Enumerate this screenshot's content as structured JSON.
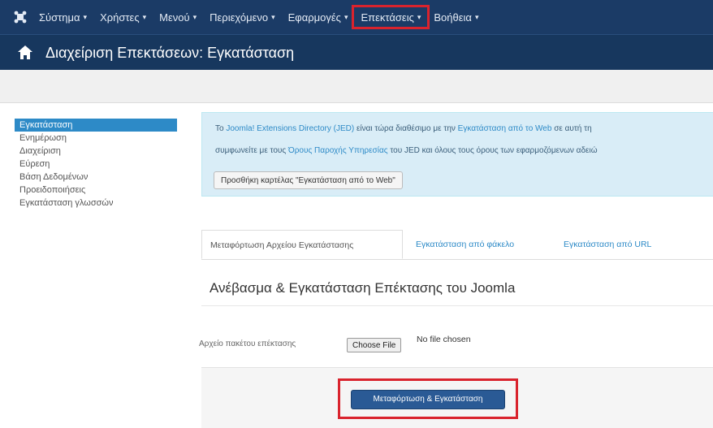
{
  "topbar": {
    "logo_icon": "joomla-logo-icon",
    "menu": [
      {
        "label": "Σύστημα"
      },
      {
        "label": "Χρήστες"
      },
      {
        "label": "Μενού"
      },
      {
        "label": "Περιεχόμενο"
      },
      {
        "label": "Εφαρμογές"
      },
      {
        "label": "Επεκτάσεις"
      },
      {
        "label": "Βοήθεια"
      }
    ],
    "caret": "▾",
    "highlight_color": "#d9232d",
    "background": "#1b3b66"
  },
  "titlebar": {
    "icon": "puzzle-home-icon",
    "title": "Διαχείριση Επεκτάσεων: Εγκατάσταση"
  },
  "sidebar": {
    "items": [
      {
        "label": "Εγκατάσταση"
      },
      {
        "label": "Ενημέρωση"
      },
      {
        "label": "Διαχείριση"
      },
      {
        "label": "Εύρεση"
      },
      {
        "label": "Βάση Δεδομένων"
      },
      {
        "label": "Προειδοποιήσεις"
      },
      {
        "label": "Εγκατάσταση γλωσσών"
      }
    ],
    "active_color": "#2d8ac7"
  },
  "notice": {
    "line1_a": "Το ",
    "line1_link1": "Joomla! Extensions Directory (JED)",
    "line1_b": " είναι τώρα διαθέσιμο με την ",
    "line1_link2": "Εγκατάσταση από το Web",
    "line1_c": " σε αυτή τη",
    "line2_a": "συμφωνείτε με τους ",
    "line2_link": "Όρους Παροχής Υπηρεσίας",
    "line2_b": " του JED και όλους τους όρους των εφαρμοζόμενων αδειώ",
    "button": "Προσθήκη καρτέλας \"Εγκατάσταση από το Web\""
  },
  "tabs": [
    {
      "label": "Μεταφόρτωση Αρχείου Εγκατάστασης"
    },
    {
      "label": "Εγκατάσταση από φάκελο"
    },
    {
      "label": "Εγκατάσταση από URL"
    }
  ],
  "section_title": "Ανέβασμα & Εγκατάσταση Επέκτασης του Joomla",
  "file_field": {
    "label": "Αρχείο πακέτου επέκτασης",
    "choose_button": "Choose File",
    "status": "No file chosen"
  },
  "upload_button": "Μεταφόρτωση & Εγκατάσταση"
}
